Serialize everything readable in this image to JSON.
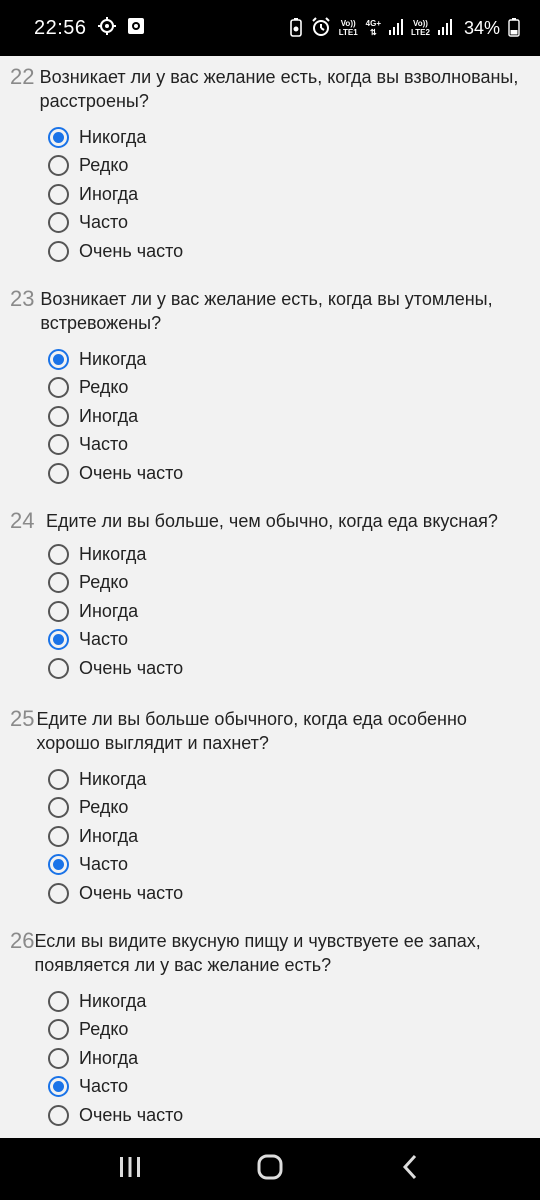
{
  "status": {
    "time": "22:56",
    "net1_top": "Vo))",
    "net1_bottom": "LTE1",
    "net_type": "4G+",
    "net2_top": "Vo))",
    "net2_bottom": "LTE2",
    "battery": "34%"
  },
  "questions": [
    {
      "number": "22",
      "text": "Возникает ли у вас желание есть, когда вы взволнованы, расстроены?",
      "options": [
        "Никогда",
        "Редко",
        "Иногда",
        "Часто",
        "Очень часто"
      ],
      "selected": 0
    },
    {
      "number": "23",
      "text": "Возникает ли у вас желание есть, когда вы утомлены, встревожены?",
      "options": [
        "Никогда",
        "Редко",
        "Иногда",
        "Часто",
        "Очень часто"
      ],
      "selected": 0
    },
    {
      "number": "24",
      "text": "Едите ли вы больше, чем обычно, когда еда вкусная?",
      "options": [
        "Никогда",
        "Редко",
        "Иногда",
        "Часто",
        "Очень часто"
      ],
      "selected": 3
    },
    {
      "number": "25",
      "text": "Едите ли вы больше обычного, когда еда особенно хорошо выглядит и пахнет?",
      "options": [
        "Никогда",
        "Редко",
        "Иногда",
        "Часто",
        "Очень часто"
      ],
      "selected": 3
    },
    {
      "number": "26",
      "text": "Если вы видите вкусную пищу и чувствуете ее запах, появляется ли у вас желание есть?",
      "options": [
        "Никогда",
        "Редко",
        "Иногда",
        "Часто",
        "Очень часто"
      ],
      "selected": 3
    }
  ],
  "nav": {
    "recents_icon": "recents-icon",
    "home_icon": "home-icon",
    "back_icon": "back-icon"
  },
  "colors": {
    "accent": "#1a73e8",
    "background": "#f2f2f2"
  }
}
